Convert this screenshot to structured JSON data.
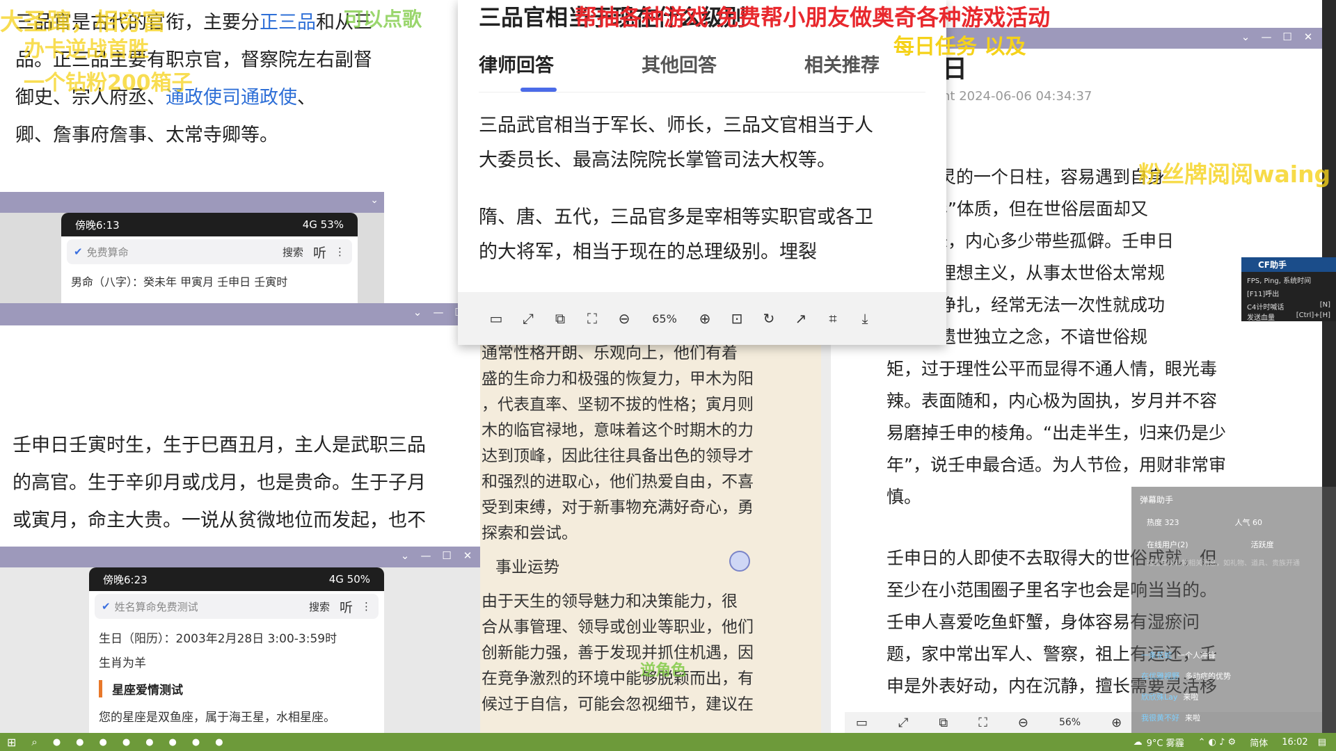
{
  "top_left_text": {
    "lines": [
      {
        "parts": [
          {
            "t": "三品官是古代的官衔，主要分"
          },
          {
            "t": "正三品",
            "link": true
          },
          {
            "t": "和从三"
          }
        ]
      },
      {
        "parts": [
          {
            "t": "品。正三品主要有职京官，督察院左右副督"
          }
        ]
      },
      {
        "parts": [
          {
            "t": "御史、宗人府丞、"
          },
          {
            "t": "通政使司通政使",
            "link": true
          },
          {
            "t": "、"
          }
        ]
      },
      {
        "parts": [
          {
            "t": "卿、詹事府詹事、太常寺卿等。"
          }
        ]
      }
    ]
  },
  "phone1": {
    "status_time": "傍晚6:13",
    "status_right": "4G 53%",
    "search_placeholder": "免费算命",
    "search_button": "搜索",
    "listen": "听",
    "content": "男命（八字）：癸未年 甲寅月 壬申日 壬寅时"
  },
  "left_mid_text": {
    "lines": [
      "壬申日壬寅时生，生于巳酉丑月，主人是武职三品",
      "的高官。生于辛卯月或戊月，也是贵命。生于子月",
      "或寅月，命主大贵。一说从贫微地位而发起，也不"
    ]
  },
  "phone2": {
    "status_time": "傍晚6:23",
    "status_right": "4G 50%",
    "search_placeholder": "姓名算命免费测试",
    "search_button": "搜索",
    "listen": "听",
    "line1": "生日（阳历）：2003年2月28日 3:00-3:59时",
    "line2": "生肖为羊",
    "section_title": "星座爱情测试",
    "line3": "您的星座是双鱼座，属于海王星，水相星座。"
  },
  "popup": {
    "title": "三品官相当于现在什么级别",
    "tabs": [
      "律师回答",
      "其他回答",
      "相关推荐"
    ],
    "para1": [
      "三品武官相当于军长、师长，三品文官相当于人",
      "大委员长、最高法院院长掌管司法大权等。"
    ],
    "para2": [
      "隋、唐、五代，三品官多是宰相等实职官或各卫",
      "的大将军，相当于现在的总理级别。埋裂"
    ],
    "zoom": "65%"
  },
  "middle_column": {
    "lines": [
      "通常性格开朗、乐观向上，他们有着",
      "盛的生命力和极强的恢复力，甲木为阳",
      "，代表直率、坚韧不拔的性格；寅月则",
      "木的临官禄地，意味着这个时期木的力",
      "达到顶峰，因此往往具备出色的领导才",
      "和强烈的进取心，他们热爱自由，不喜",
      "受到束缚，对于新事物充满好奇心，勇",
      "探索和尝试。"
    ],
    "heading": "事业运势",
    "lines2": [
      "由于天生的领导魅力和决策能力，很",
      "合从事管理、领导或创业等职业，他们",
      "创新能力强，善于发现并抓住机遇，因",
      "在竞争激烈的环境中能够脱颖而出，有",
      "候过于自信，可能会忽视细节，建议在"
    ]
  },
  "right_window": {
    "title_fragment": "日",
    "meta": "nt 2024-06-06 04:34:37",
    "lines": [
      "比较通灵的一个日柱，容易遇到自身",
      "带“灵异”体质，但在世俗层面却又",
      "”的意味，内心多少带些孤僻。壬申日",
      "体比较理想主义，从事太世俗太常规",
      "会比较挣扎，经常无法一次性就成功",
      "常心生遗世独立之念，不谙世俗规",
      "矩，过于理性公平而显得不通人情，眼光毒",
      "辣。表面随和，内心极为固执，岁月并不容",
      "易磨掉壬申的棱角。“出走半生，归来仍是少",
      "年”，说壬申最合适。为人节俭，用财非常审",
      "慎。"
    ],
    "lines2": [
      "壬申日的人即使不去取得大的世俗成就，但",
      "至少在小范围圈子里名字也会是响当当的。",
      "壬申人喜爱吃鱼虾蟹，身体容易有湿瘀问",
      "题，家中常出军人、警察，祖上有运还，壬",
      "申是外表好动，内在沉静，擅长需要灵活移"
    ],
    "zoom": "56%"
  },
  "cf_panel": {
    "title": "CF助手",
    "row1": "FPS, Ping, 系统时间",
    "row1b": "[F11]呼出",
    "row2": "C4计时喊话",
    "row2b": "发送血量",
    "row2c": "[N]",
    "row2d": "[Ctrl]+[H]"
  },
  "danmu_panel": {
    "title": "弹幕助手",
    "hot": "热度 323",
    "popularity": "人气 60",
    "online": "在线用户(2)",
    "activity": "活跃度",
    "hint": "这里显示礼物相关消息，如礼物、道具、贵族开通",
    "messages": [
      {
        "user": "一条花蛇",
        "text": "一个人冲锋"
      },
      {
        "user": "在优雅视野",
        "text": "多动症的优势"
      },
      {
        "user": "欣欣殊Lay",
        "text": "来啦"
      },
      {
        "user": "我很黄不好",
        "text": "来啦"
      }
    ]
  },
  "stream_overlays": {
    "top_left_1": "大圣蹿，相穷富",
    "top_left_2": "可以点歌",
    "top_left_3": "办卡逆战首胜",
    "top_left_4": "一个钻粉200箱子",
    "top_red": "帮抽各种游戏 免费帮小朋友做奥奇各种游戏活动",
    "top_yellow": "每日任务 以及",
    "right_yellow": "粉丝牌阅阅waing",
    "bottom_small": "逆角色"
  },
  "taskbar": {
    "weather": "9°C 雾霾",
    "ime": "简体",
    "time": "16:02"
  },
  "colors": {
    "titlebar": "#9d99bb",
    "link": "#2e6fd7",
    "taskbar": "#6d9a3a",
    "tab_indicator": "#4b6be8",
    "overlay_red": "#e8282d",
    "overlay_yellow": "#f5d21a",
    "sepia_bg": "#f4ecdc"
  }
}
